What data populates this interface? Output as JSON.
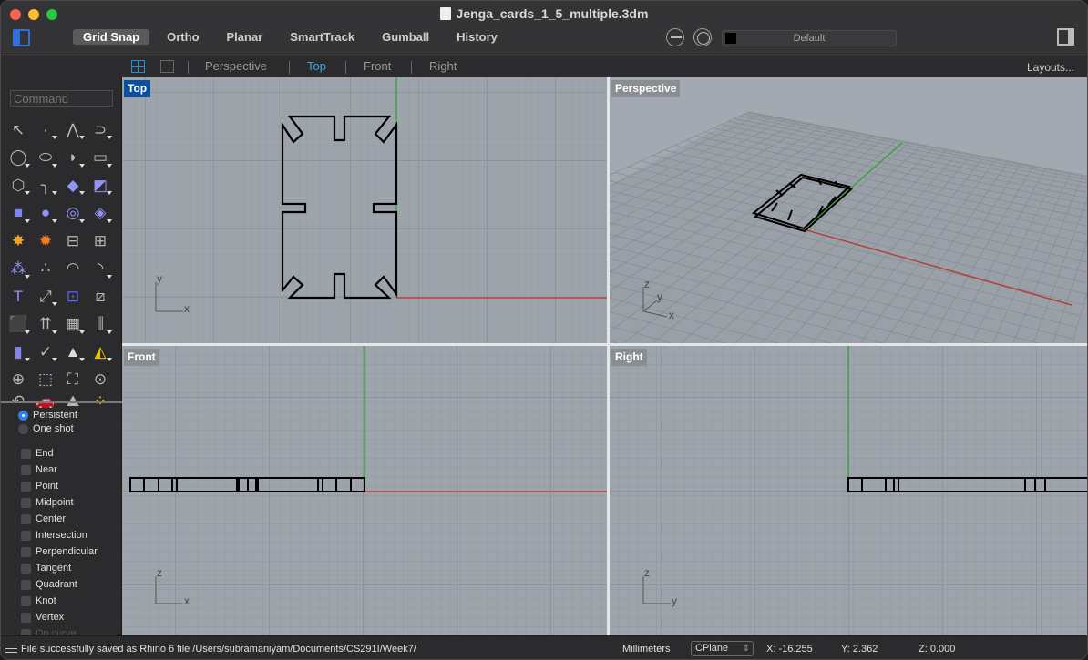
{
  "window": {
    "title": "Jenga_cards_1_5_multiple.3dm",
    "controls": [
      "close",
      "minimize",
      "maximize"
    ]
  },
  "toolbar": {
    "modes": [
      {
        "label": "Grid Snap",
        "active": true
      },
      {
        "label": "Ortho",
        "active": false
      },
      {
        "label": "Planar",
        "active": false
      },
      {
        "label": "SmartTrack",
        "active": false
      },
      {
        "label": "Gumball",
        "active": false
      },
      {
        "label": "History",
        "active": false
      }
    ],
    "layer": {
      "name": "Default",
      "color": "#000000"
    },
    "icons": [
      "sidebar-toggle-icon",
      "osnap-toggle-icon",
      "record-history-icon",
      "panel-toggle-icon"
    ]
  },
  "viewport_tabs": {
    "tabs": [
      {
        "label": "Perspective",
        "active": false
      },
      {
        "label": "Top",
        "active": true
      },
      {
        "label": "Front",
        "active": false
      },
      {
        "label": "Right",
        "active": false
      }
    ],
    "layouts_label": "Layouts...",
    "accent": "#38a8e6"
  },
  "command": {
    "placeholder": "Command",
    "value": ""
  },
  "tools": [
    {
      "name": "select",
      "glyph": "↖",
      "flyout": false
    },
    {
      "name": "point",
      "glyph": "·",
      "flyout": true
    },
    {
      "name": "polyline",
      "glyph": "⋀",
      "flyout": true
    },
    {
      "name": "curve",
      "glyph": "⊃",
      "flyout": true
    },
    {
      "name": "circle",
      "glyph": "◯",
      "flyout": true
    },
    {
      "name": "ellipse",
      "glyph": "⬭",
      "flyout": true
    },
    {
      "name": "arc",
      "glyph": "◗",
      "flyout": true
    },
    {
      "name": "rectangle",
      "glyph": "▭",
      "flyout": true
    },
    {
      "name": "polygon",
      "glyph": "⬡",
      "flyout": true
    },
    {
      "name": "fillet-curve",
      "glyph": "╮",
      "flyout": true
    },
    {
      "name": "surface-corner",
      "glyph": "◆",
      "flyout": true
    },
    {
      "name": "extrude-surface",
      "glyph": "◩",
      "flyout": true
    },
    {
      "name": "box",
      "glyph": "■",
      "flyout": true
    },
    {
      "name": "sphere",
      "glyph": "●",
      "flyout": true
    },
    {
      "name": "cylinder",
      "glyph": "◎",
      "flyout": true
    },
    {
      "name": "mesh",
      "glyph": "◈",
      "flyout": true
    },
    {
      "name": "explode",
      "glyph": "✸",
      "flyout": false
    },
    {
      "name": "boolean",
      "glyph": "✹",
      "flyout": false
    },
    {
      "name": "trim",
      "glyph": "⊟",
      "flyout": false
    },
    {
      "name": "split",
      "glyph": "⊞",
      "flyout": false
    },
    {
      "name": "boolean-union",
      "glyph": "⁂",
      "flyout": true
    },
    {
      "name": "group",
      "glyph": "∴",
      "flyout": false
    },
    {
      "name": "offset",
      "glyph": "◠",
      "flyout": false
    },
    {
      "name": "rebuild",
      "glyph": "◝",
      "flyout": true
    },
    {
      "name": "text",
      "glyph": "T",
      "flyout": false
    },
    {
      "name": "scale",
      "glyph": "⤢",
      "flyout": true
    },
    {
      "name": "array",
      "glyph": "⊡",
      "flyout": false
    },
    {
      "name": "mirror",
      "glyph": "⧄",
      "flyout": false
    },
    {
      "name": "solid-tools",
      "glyph": "⬛",
      "flyout": true
    },
    {
      "name": "extrude-normal",
      "glyph": "⇈",
      "flyout": true
    },
    {
      "name": "grid-array",
      "glyph": "▦",
      "flyout": true
    },
    {
      "name": "split-section",
      "glyph": "⫼",
      "flyout": true
    },
    {
      "name": "render-material",
      "glyph": "▮",
      "flyout": true
    },
    {
      "name": "check",
      "glyph": "✓",
      "flyout": true
    },
    {
      "name": "shapes",
      "glyph": "▲",
      "flyout": true
    },
    {
      "name": "properties",
      "glyph": "◭",
      "flyout": true
    },
    {
      "name": "zoom-in-out",
      "glyph": "⊕",
      "flyout": false
    },
    {
      "name": "zoom-window",
      "glyph": "⬚",
      "flyout": false
    },
    {
      "name": "zoom-extents",
      "glyph": "⛶",
      "flyout": false
    },
    {
      "name": "zoom-selected",
      "glyph": "⊙",
      "flyout": false
    },
    {
      "name": "undo-view",
      "glyph": "↶",
      "flyout": false
    },
    {
      "name": "car",
      "glyph": "🚗",
      "flyout": false
    },
    {
      "name": "terrain",
      "glyph": "⛰",
      "flyout": false
    },
    {
      "name": "points-on",
      "glyph": "⁘",
      "flyout": false
    }
  ],
  "osnap": {
    "modes": [
      {
        "label": "Persistent",
        "checked": true
      },
      {
        "label": "One shot",
        "checked": false
      }
    ],
    "snaps": [
      {
        "label": "End",
        "checked": false
      },
      {
        "label": "Near",
        "checked": false
      },
      {
        "label": "Point",
        "checked": false
      },
      {
        "label": "Midpoint",
        "checked": false
      },
      {
        "label": "Center",
        "checked": false
      },
      {
        "label": "Intersection",
        "checked": false
      },
      {
        "label": "Perpendicular",
        "checked": false
      },
      {
        "label": "Tangent",
        "checked": false
      },
      {
        "label": "Quadrant",
        "checked": false
      },
      {
        "label": "Knot",
        "checked": false
      },
      {
        "label": "Vertex",
        "checked": false
      },
      {
        "label": "On curve",
        "checked": false
      }
    ]
  },
  "viewports": {
    "top": {
      "label": "Top",
      "active": true,
      "axis_labels": [
        "y",
        "x"
      ]
    },
    "perspective": {
      "label": "Perspective",
      "active": false,
      "axis_labels": [
        "z",
        "y",
        "x"
      ]
    },
    "front": {
      "label": "Front",
      "active": false,
      "axis_labels": [
        "z",
        "x"
      ]
    },
    "right": {
      "label": "Right",
      "active": false,
      "axis_labels": [
        "z",
        "y"
      ]
    },
    "colors": {
      "x_axis": "#b5403a",
      "y_axis": "#3fa33f",
      "grid_bg": "#9ea4ab",
      "active_label": "#0c4f9c"
    }
  },
  "status": {
    "message": "File successfully saved as Rhino 6 file /Users/subramaniyam/Documents/CS291I/Week7/",
    "units": "Millimeters",
    "cplane": "CPlane",
    "x": "X: -16.255",
    "y": "Y: 2.362",
    "z": "Z: 0.000"
  }
}
